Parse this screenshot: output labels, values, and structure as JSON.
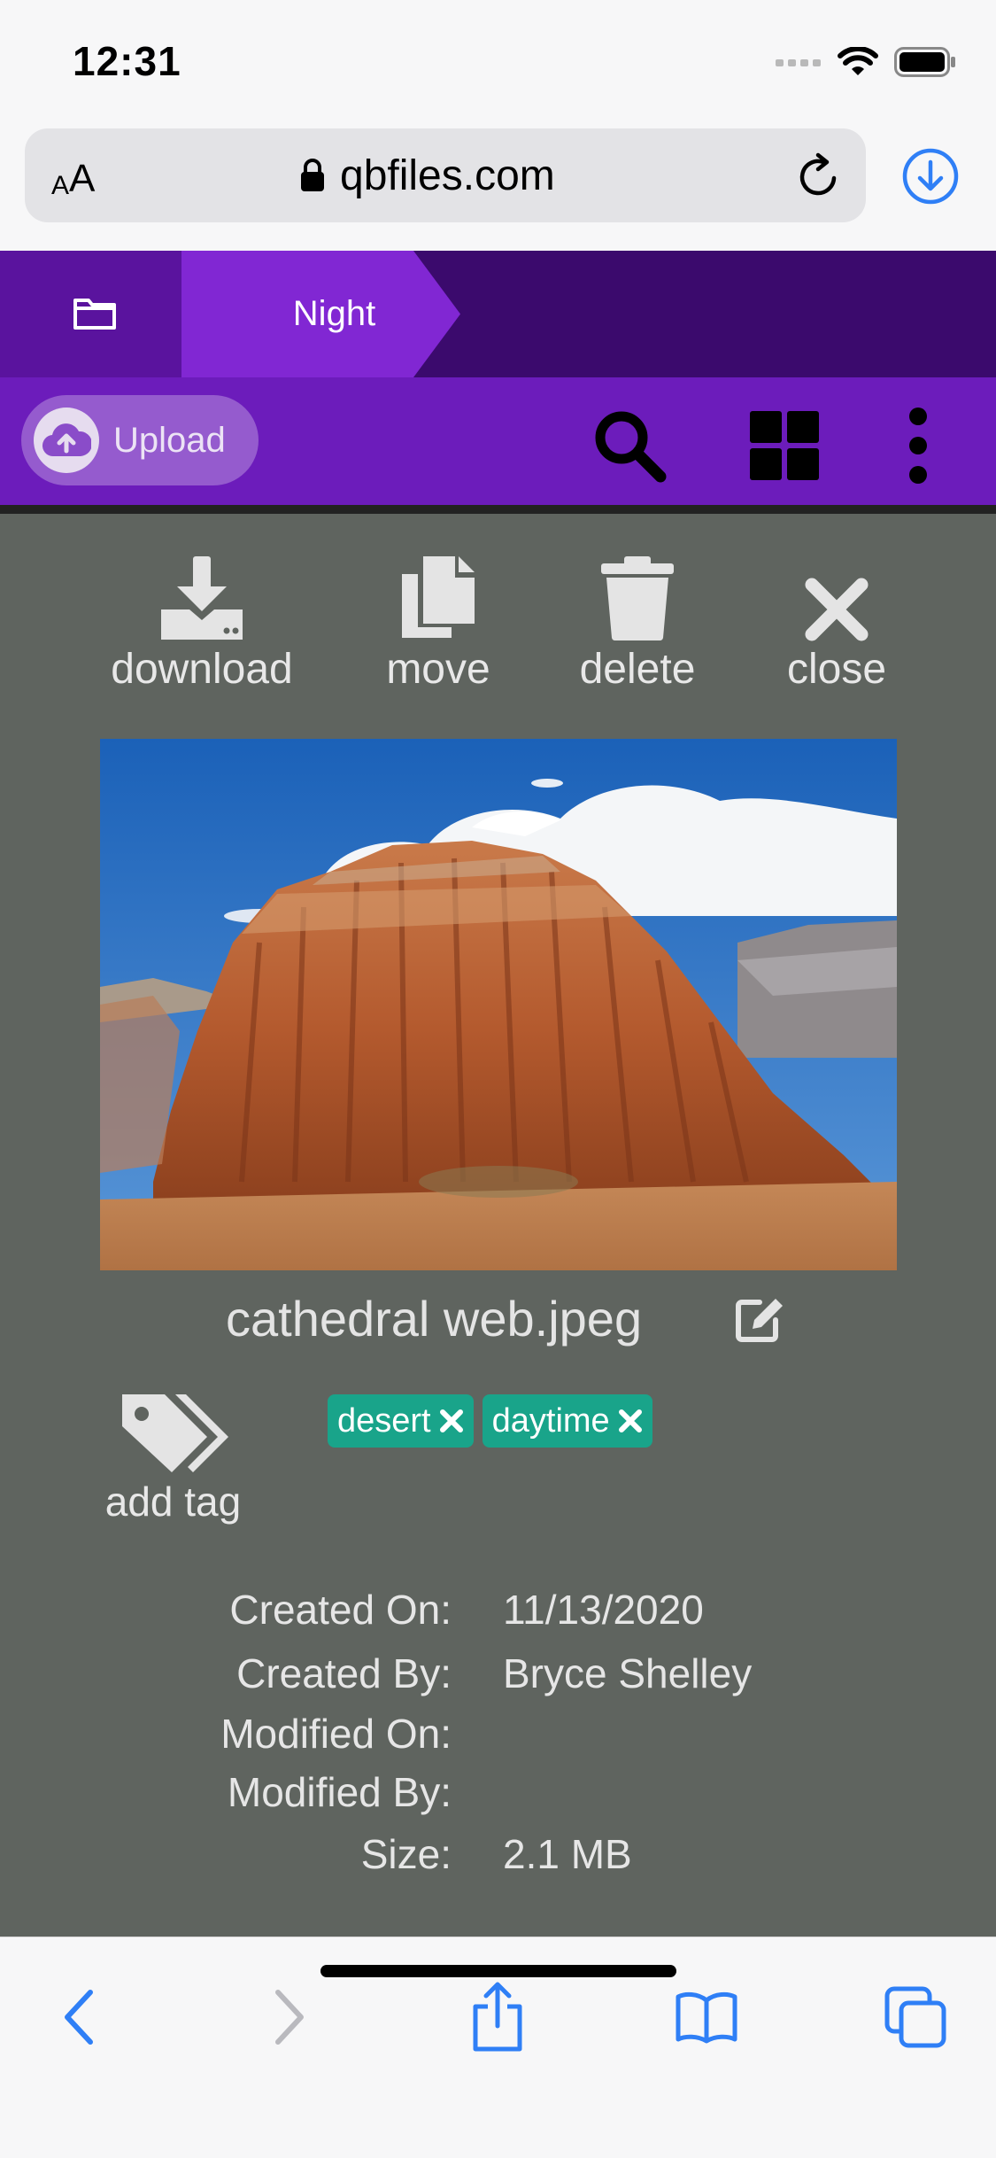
{
  "status_bar": {
    "time": "12:31"
  },
  "browser": {
    "text_size_small": "A",
    "text_size_big": "A",
    "url": "qbfiles.com"
  },
  "breadcrumb": {
    "current": "Night"
  },
  "toolbar": {
    "upload_label": "Upload"
  },
  "actions": {
    "download": "download",
    "move": "move",
    "delete": "delete",
    "close": "close"
  },
  "file": {
    "name": "cathedral web.jpeg",
    "add_tag_label": "add tag",
    "tags": [
      "desert",
      "daytime"
    ]
  },
  "metadata": [
    {
      "key": "Created On:",
      "value": "11/13/2020"
    },
    {
      "key": "Created By:",
      "value": "Bryce Shelley"
    },
    {
      "key": "Modified On:",
      "value": ""
    },
    {
      "key": "Modified By:",
      "value": ""
    },
    {
      "key": "Size:",
      "value": "2.1 MB"
    }
  ],
  "colors": {
    "breadcrumb_dark": "#3b0a6d",
    "breadcrumb_home": "#5a139e",
    "breadcrumb_active": "#8127d3",
    "toolbar": "#6c1cbb",
    "panel": "#5f645f",
    "tag": "#19a48a",
    "ios_blue": "#2f7ff6"
  },
  "icons": [
    "signal-icon",
    "wifi-icon",
    "battery-icon",
    "lock-icon",
    "reload-icon",
    "download-circle-icon",
    "folder-icon",
    "cloud-upload-icon",
    "search-icon",
    "grid-icon",
    "more-vertical-icon",
    "download-icon",
    "copy-icon",
    "trash-icon",
    "close-icon",
    "edit-icon",
    "tags-icon",
    "back-icon",
    "forward-icon",
    "share-icon",
    "bookmarks-icon",
    "tabs-icon"
  ]
}
